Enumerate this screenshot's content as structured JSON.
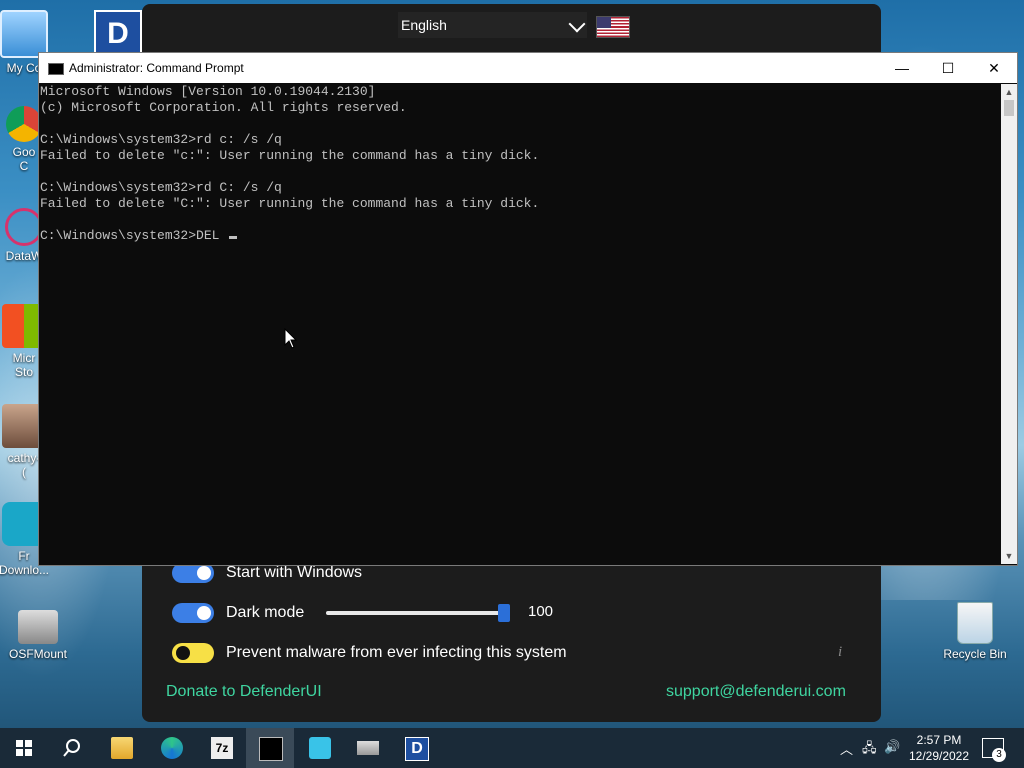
{
  "desktop": {
    "icons": [
      {
        "label": "My Co",
        "icon": "computer-icon"
      },
      {
        "label": "Goo\nC",
        "icon": "chrome-icon"
      },
      {
        "label": "DataW",
        "icon": "datawrapper-icon"
      },
      {
        "label": "Micr\nSto",
        "icon": "store-icon"
      },
      {
        "label": "cathy-\n(",
        "icon": "photo-icon"
      },
      {
        "label": "Fr\nDownlo...",
        "icon": "download-icon"
      },
      {
        "label": "OSFMount",
        "icon": "osfmount-icon"
      },
      {
        "label": "Recycle Bin",
        "icon": "recycle-bin-icon"
      }
    ]
  },
  "defender": {
    "language": "English",
    "settings": {
      "start_with_windows": "Start with Windows",
      "dark_mode": "Dark mode",
      "dark_mode_level": "100",
      "prevent_malware": "Prevent malware from ever infecting this system"
    },
    "donate_link": "Donate to DefenderUI",
    "support_link": "support@defenderui.com",
    "info_glyph": "i",
    "colors": {
      "toggle_on": "#3c7fe6",
      "toggle_warn": "#f7e046",
      "link": "#3fd5a0"
    }
  },
  "cmd": {
    "title": "Administrator: Command Prompt",
    "lines": [
      "Microsoft Windows [Version 10.0.19044.2130]",
      "(c) Microsoft Corporation. All rights reserved.",
      "",
      "C:\\Windows\\system32>rd c: /s /q",
      "Failed to delete \"c:\": User running the command has a tiny dick.",
      "",
      "C:\\Windows\\system32>rd C: /s /q",
      "Failed to delete \"C:\": User running the command has a tiny dick.",
      "",
      "C:\\Windows\\system32>DEL "
    ],
    "minimize": "—",
    "maximize": "☐",
    "close": "✕"
  },
  "taskbar": {
    "time": "2:57 PM",
    "date": "12/29/2022",
    "notification_count": "3",
    "apps": [
      "start-icon",
      "search-icon",
      "file-explorer-icon",
      "edge-icon",
      "7zip-icon",
      "cmd-icon",
      "remote-icon",
      "drive-icon",
      "defenderui-icon"
    ]
  }
}
